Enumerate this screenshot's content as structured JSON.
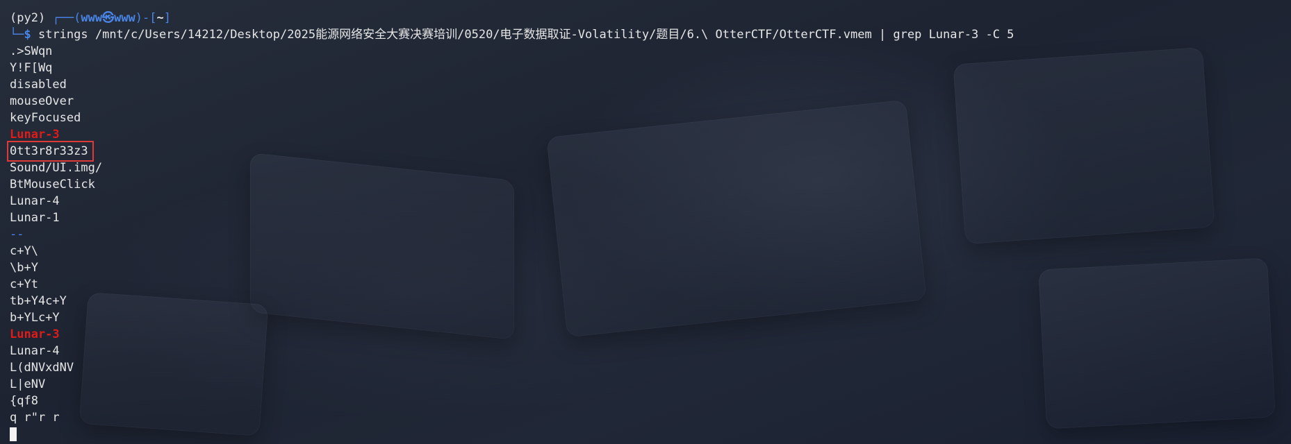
{
  "prompt": {
    "env": "(py2) ",
    "frame_top": "┌──(",
    "user": "www㉿www",
    "mid": ")-[",
    "path": "~",
    "end": "]",
    "frame_bottom": "└─",
    "dollar": "$",
    "command": " strings /mnt/c/Users/14212/Desktop/2025能源网络安全大赛决赛培训/0520/电子数据取证-Volatility/题目/6.\\ OtterCTF/OtterCTF.vmem | grep Lunar-3 -C 5"
  },
  "output": [
    {
      "text": ".>SWqn",
      "kind": "normal"
    },
    {
      "text": "Y!F[Wq",
      "kind": "normal"
    },
    {
      "text": "disabled",
      "kind": "normal"
    },
    {
      "text": "mouseOver",
      "kind": "normal"
    },
    {
      "text": "keyFocused",
      "kind": "normal"
    },
    {
      "text": "Lunar-3",
      "kind": "match"
    },
    {
      "text": "0tt3r8r33z3",
      "kind": "boxed"
    },
    {
      "text": "Sound/UI.img/",
      "kind": "normal"
    },
    {
      "text": "BtMouseClick",
      "kind": "normal"
    },
    {
      "text": "Lunar-4",
      "kind": "normal"
    },
    {
      "text": "Lunar-1",
      "kind": "normal"
    },
    {
      "text": "--",
      "kind": "separator"
    },
    {
      "text": "c+Y\\",
      "kind": "normal"
    },
    {
      "text": "\\b+Y",
      "kind": "normal"
    },
    {
      "text": "c+Yt",
      "kind": "normal"
    },
    {
      "text": "tb+Y4c+Y",
      "kind": "normal"
    },
    {
      "text": "b+YLc+Y",
      "kind": "normal"
    },
    {
      "text": "Lunar-3",
      "kind": "match"
    },
    {
      "text": "Lunar-4",
      "kind": "normal"
    },
    {
      "text": "L(dNVxdNV",
      "kind": "normal"
    },
    {
      "text": "L|eNV",
      "kind": "normal"
    },
    {
      "text": "{qf8",
      "kind": "normal"
    },
    {
      "text": "q r\"r r",
      "kind": "normal"
    }
  ],
  "colors": {
    "background": "#1c2230",
    "text": "#e6e6e6",
    "prompt_accent": "#4a86e8",
    "match": "#e01b1b",
    "highlight_box": "#e0393a"
  }
}
